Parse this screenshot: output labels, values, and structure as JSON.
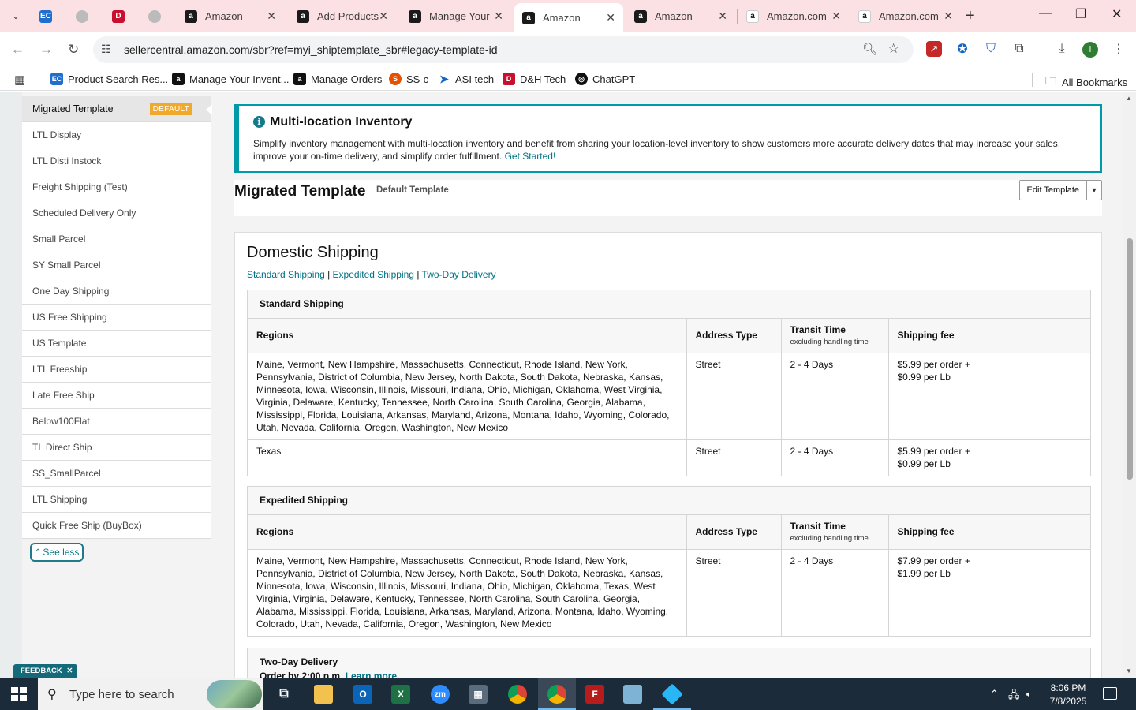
{
  "browser": {
    "tabs": [
      {
        "label": "",
        "favicon": "ec-icon"
      },
      {
        "label": "",
        "favicon": "globe-icon"
      },
      {
        "label": "",
        "favicon": "dh-icon"
      },
      {
        "label": "",
        "favicon": "globe-icon"
      },
      {
        "label": "Amazon",
        "favicon": "amazon-icon"
      },
      {
        "label": "Add Products",
        "favicon": "amazon-icon"
      },
      {
        "label": "Manage Your",
        "favicon": "amazon-icon"
      },
      {
        "label": "Amazon",
        "favicon": "amazon-icon",
        "active": true
      },
      {
        "label": "Amazon",
        "favicon": "amazon-icon"
      },
      {
        "label": "Amazon.com",
        "favicon": "amazon-icon"
      },
      {
        "label": "Amazon.com",
        "favicon": "amazon-icon"
      }
    ],
    "url": "sellercentral.amazon.com/sbr?ref=myi_shiptemplate_sbr#legacy-template-id",
    "bookmarks": [
      {
        "label": "Product Search Res...",
        "icon": "ec-icon"
      },
      {
        "label": "Manage Your Invent...",
        "icon": "amazon-icon"
      },
      {
        "label": "Manage Orders",
        "icon": "amazon-icon"
      },
      {
        "label": "SS-c",
        "icon": "ssc-icon"
      },
      {
        "label": "ASI tech",
        "icon": "asi-icon"
      },
      {
        "label": "D&H Tech",
        "icon": "dh-icon"
      },
      {
        "label": "ChatGPT",
        "icon": "chatgpt-icon"
      }
    ],
    "all_bookmarks": "All Bookmarks",
    "profile_initial": "i"
  },
  "sidebar": {
    "items": [
      {
        "label": "Migrated Template",
        "badge": "DEFAULT"
      },
      {
        "label": "LTL Display"
      },
      {
        "label": "LTL Disti Instock"
      },
      {
        "label": "Freight Shipping (Test)"
      },
      {
        "label": "Scheduled Delivery Only"
      },
      {
        "label": "Small Parcel"
      },
      {
        "label": "SY Small Parcel"
      },
      {
        "label": "One Day Shipping"
      },
      {
        "label": "US Free Shipping"
      },
      {
        "label": "US Template"
      },
      {
        "label": "LTL Freeship"
      },
      {
        "label": "Late Free Ship"
      },
      {
        "label": "Below100Flat"
      },
      {
        "label": "TL Direct Ship"
      },
      {
        "label": "SS_SmallParcel"
      },
      {
        "label": "LTL Shipping"
      },
      {
        "label": "Quick Free Ship (BuyBox)"
      }
    ],
    "see_less": "See less"
  },
  "info": {
    "title": "Multi-location Inventory",
    "text": "Simplify inventory management with multi-location inventory and benefit from sharing your location-level inventory to show customers more accurate delivery dates that may increase your sales, improve your on-time delivery, and simplify order fulfillment.",
    "link": "Get Started!"
  },
  "template": {
    "name": "Migrated Template",
    "subtitle": "Default Template",
    "edit_label": "Edit Template"
  },
  "domestic": {
    "heading": "Domestic Shipping",
    "anchors": [
      "Standard Shipping",
      "Expedited Shipping",
      "Two-Day Delivery"
    ],
    "columns": {
      "regions": "Regions",
      "address_type": "Address Type",
      "transit_time": "Transit Time",
      "transit_sub": "excluding handling time",
      "fee": "Shipping fee"
    },
    "standard": {
      "title": "Standard Shipping",
      "rows": [
        {
          "regions": "Maine, Vermont, New Hampshire, Massachusetts, Connecticut, Rhode Island, New York, Pennsylvania, District of Columbia, New Jersey, North Dakota, South Dakota, Nebraska, Kansas, Minnesota, Iowa, Wisconsin, Illinois, Missouri, Indiana, Ohio, Michigan, Oklahoma, West Virginia, Virginia, Delaware, Kentucky, Tennessee, North Carolina, South Carolina, Georgia, Alabama, Mississippi, Florida, Louisiana, Arkansas, Maryland, Arizona, Montana, Idaho, Wyoming, Colorado, Utah, Nevada, California, Oregon, Washington, New Mexico",
          "address_type": "Street",
          "transit": "2 - 4 Days",
          "fee_line1": "$5.99 per order +",
          "fee_line2": "$0.99 per Lb"
        },
        {
          "regions": "Texas",
          "address_type": "Street",
          "transit": "2 - 4 Days",
          "fee_line1": "$5.99 per order +",
          "fee_line2": "$0.99 per Lb"
        }
      ]
    },
    "expedited": {
      "title": "Expedited Shipping",
      "rows": [
        {
          "regions": "Maine, Vermont, New Hampshire, Massachusetts, Connecticut, Rhode Island, New York, Pennsylvania, District of Columbia, New Jersey, North Dakota, South Dakota, Nebraska, Kansas, Minnesota, Iowa, Wisconsin, Illinois, Missouri, Indiana, Ohio, Michigan, Oklahoma, Texas, West Virginia, Virginia, Delaware, Kentucky, Tennessee, North Carolina, South Carolina, Georgia, Alabama, Mississippi, Florida, Louisiana, Arkansas, Maryland, Arizona, Montana, Idaho, Wyoming, Colorado, Utah, Nevada, California, Oregon, Washington, New Mexico",
          "address_type": "Street",
          "transit": "2 - 4 Days",
          "fee_line1": "$7.99 per order +",
          "fee_line2": "$1.99 per Lb"
        }
      ]
    },
    "twoday": {
      "title": "Two-Day Delivery",
      "order_by": "Order by 2:00 p.m.",
      "learn_more": "Learn more"
    }
  },
  "feedback": "FEEDBACK",
  "taskbar": {
    "search_placeholder": "Type here to search",
    "time": "8:06 PM",
    "date": "7/8/2025"
  },
  "colors": {
    "accent_teal": "#007185",
    "badge_orange": "#f0a92c",
    "tab_strip": "#fbe0e4"
  }
}
